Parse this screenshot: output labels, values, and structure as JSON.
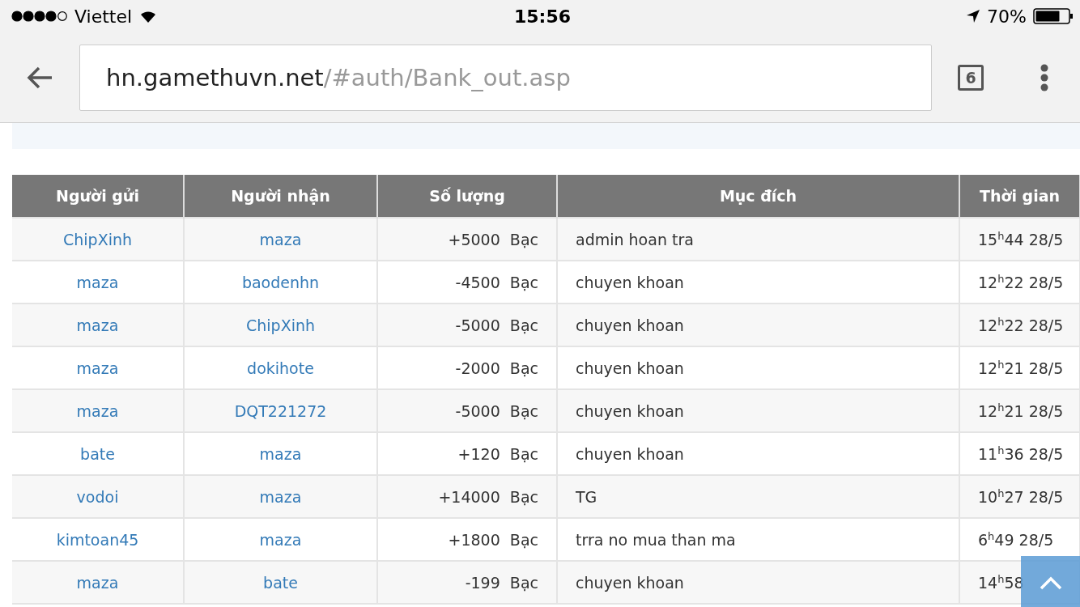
{
  "status_bar": {
    "carrier": "Viettel",
    "time": "15:56",
    "battery": "70%"
  },
  "toolbar": {
    "url_host": "hn.gamethuvn.net",
    "url_path": "/#auth/Bank_out.asp",
    "tab_count": "6"
  },
  "table": {
    "columns": [
      "Người gửi",
      "Người nhận",
      "Số lượng",
      "Mục đích",
      "Thời gian"
    ],
    "rows": [
      {
        "sender": "ChipXinh",
        "receiver": "maza",
        "amount": "+5000  Bạc",
        "purpose": "admin hoan tra",
        "time": "15$^{h}$44 28/5"
      },
      {
        "sender": "maza",
        "receiver": "baodenhn",
        "amount": "-4500  Bạc",
        "purpose": "chuyen khoan",
        "time": "12$^{h}$22 28/5"
      },
      {
        "sender": "maza",
        "receiver": "ChipXinh",
        "amount": "-5000  Bạc",
        "purpose": "chuyen khoan",
        "time": "12$^{h}$22 28/5"
      },
      {
        "sender": "maza",
        "receiver": "dokihote",
        "amount": "-2000  Bạc",
        "purpose": "chuyen khoan",
        "time": "12$^{h}$21 28/5"
      },
      {
        "sender": "maza",
        "receiver": "DQT221272",
        "amount": "-5000  Bạc",
        "purpose": "chuyen khoan",
        "time": "12$^{h}$21 28/5"
      },
      {
        "sender": "bate",
        "receiver": "maza",
        "amount": "+120  Bạc",
        "purpose": "chuyen khoan",
        "time": "11$^{h}$36 28/5"
      },
      {
        "sender": "vodoi",
        "receiver": "maza",
        "amount": "+14000  Bạc",
        "purpose": "TG",
        "time": "10$^{h}$27 28/5"
      },
      {
        "sender": "kimtoan45",
        "receiver": "maza",
        "amount": "+1800  Bạc",
        "purpose": "trra no mua than ma",
        "time": "6$^{h}$49 28/5"
      },
      {
        "sender": "maza",
        "receiver": "bate",
        "amount": "-199  Bạc",
        "purpose": "chuyen khoan",
        "time": "14$^{h}$58"
      }
    ]
  }
}
